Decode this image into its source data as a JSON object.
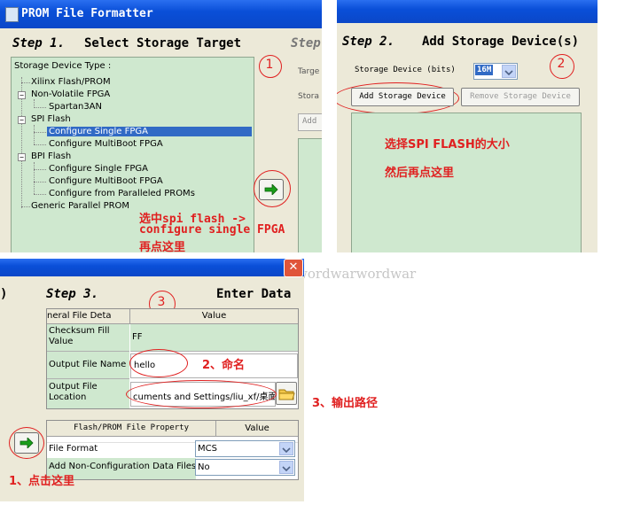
{
  "panel1": {
    "window_title": "PROM File Formatter",
    "step_label": "Step 1.",
    "step_title": "Select Storage Target",
    "next_step_label": "Step",
    "tree_header": "Storage Device Type :",
    "tree": {
      "xilinx": "Xilinx Flash/PROM",
      "nonvolatile": "Non-Volatile FPGA",
      "spartan": "Spartan3AN",
      "spi": "SPI Flash",
      "spi_single": "Configure Single FPGA",
      "spi_multi": "Configure MultiBoot FPGA",
      "bpi": "BPI Flash",
      "bpi_single": "Configure Single FPGA",
      "bpi_multi": "Configure MultiBoot FPGA",
      "bpi_parallel": "Configure from Paralleled PROMs",
      "generic": "Generic Parallel PROM"
    },
    "side_labels": {
      "target": "Targe",
      "storage": "Stora",
      "add": "Add"
    },
    "annotation_num": "1",
    "annotation": [
      "选中spi flash ->",
      "configure single FPGA",
      "再点这里"
    ]
  },
  "panel2": {
    "step_label": "Step 2.",
    "step_title": "Add Storage Device(s)",
    "storage_label": "Storage Device (bits)",
    "storage_value": "16M",
    "add_button": "Add Storage Device",
    "remove_button": "Remove Storage Device",
    "annotation_num": "2",
    "annotation": [
      "选择SPI FLASH的大小",
      "然后再点这里"
    ]
  },
  "panel3": {
    "close_glyph": "✕",
    "edge_char": ")",
    "step_label": "Step 3.",
    "step_title": "Enter Data",
    "annotation_num": "3",
    "grid1_header": [
      "neral File Deta",
      "Value"
    ],
    "grid1_rows": [
      {
        "label": "Checksum Fill Value",
        "value": "FF"
      },
      {
        "label": "Output File Name",
        "value": "hello"
      },
      {
        "label": "Output File Location",
        "value": "cuments and Settings/liu_xf/桌面"
      }
    ],
    "grid2_header": [
      "Flash/PROM File Property",
      "Value"
    ],
    "grid2_rows": [
      {
        "label": "File Format",
        "value": "MCS"
      },
      {
        "label": "Add Non-Configuration Data Files",
        "value": "No"
      }
    ],
    "note_name": "2、命名",
    "note_path": "3、输出路径",
    "note_click": "1、点击这里"
  },
  "watermark": "http://blog.csdn.net/wordwarwordwar",
  "colors": {
    "titlebar": "#0a4fd8",
    "annotation_red": "#e02020",
    "tree_bg": "#cfe8cf",
    "selection": "#316ac5"
  }
}
